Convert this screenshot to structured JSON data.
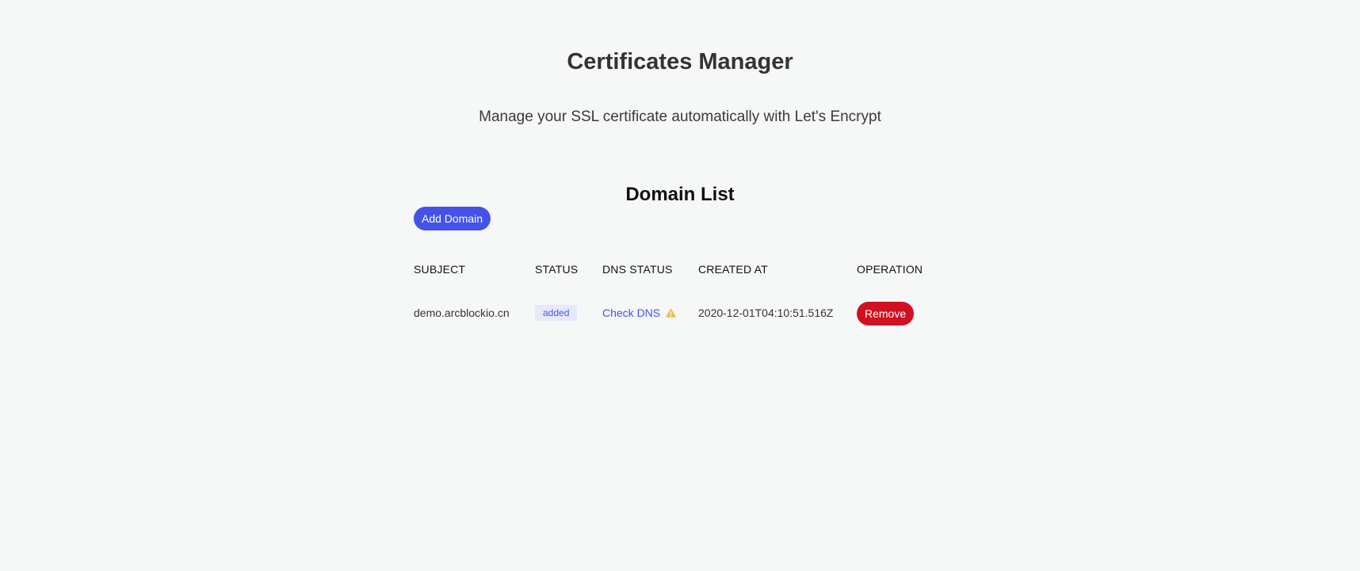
{
  "header": {
    "title": "Certificates Manager",
    "subtitle": "Manage your SSL certificate automatically with Let's Encrypt"
  },
  "domain_list": {
    "title": "Domain List",
    "add_button_label": "Add Domain",
    "columns": [
      "SUBJECT",
      "STATUS",
      "DNS STATUS",
      "CREATED AT",
      "OPERATION"
    ],
    "rows": [
      {
        "subject": "demo.arcblockio.cn",
        "status": "added",
        "dns_status": "Check DNS",
        "dns_status_icon": "warning-icon",
        "created_at": "2020-12-01T04:10:51.516Z",
        "operation_label": "Remove"
      }
    ]
  },
  "colors": {
    "background": "#f6f7f7",
    "primary": "#4353ea",
    "danger": "#cf1122",
    "warning": "#f5b945",
    "badge_background": "#e7e9fb"
  }
}
